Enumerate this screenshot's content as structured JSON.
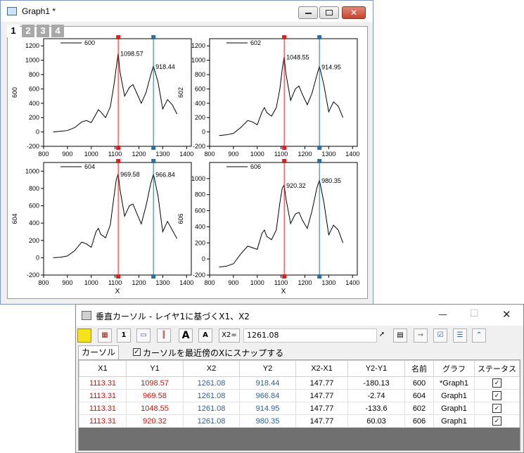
{
  "graph_window": {
    "title": "Graph1 *",
    "layer_tabs": [
      "1",
      "2",
      "3",
      "4"
    ],
    "close_glyph": "✕"
  },
  "charts": [
    {
      "ylabel": "600",
      "legend": "600",
      "xlabel": "",
      "labels": [
        "1098.57",
        "918.44"
      ]
    },
    {
      "ylabel": "602",
      "legend": "602",
      "xlabel": "",
      "labels": [
        "1048.55",
        "914.95"
      ]
    },
    {
      "ylabel": "604",
      "legend": "604",
      "xlabel": "X",
      "labels": [
        "969.58",
        "966.84"
      ]
    },
    {
      "ylabel": "606",
      "legend": "606",
      "xlabel": "X",
      "labels": [
        "920.32",
        "980.35"
      ]
    }
  ],
  "chart_data": [
    {
      "type": "line",
      "series": [
        {
          "name": "600",
          "color": "#000000",
          "x": [
            840,
            870,
            900,
            930,
            960,
            980,
            1000,
            1020,
            1030,
            1040,
            1060,
            1080,
            1095,
            1105,
            1113,
            1120,
            1140,
            1160,
            1175,
            1190,
            1210,
            1230,
            1250,
            1261,
            1280,
            1300,
            1320,
            1340,
            1360
          ],
          "y": [
            0,
            10,
            20,
            60,
            140,
            160,
            130,
            250,
            310,
            280,
            200,
            350,
            650,
            900,
            1098,
            850,
            500,
            620,
            660,
            550,
            400,
            550,
            800,
            918,
            700,
            320,
            450,
            380,
            250
          ]
        }
      ],
      "xlim": [
        800,
        1420
      ],
      "ylim": [
        -200,
        1300
      ],
      "xticks": [
        800,
        900,
        1000,
        1100,
        1200,
        1300,
        1400
      ],
      "yticks": [
        -200,
        0,
        200,
        400,
        600,
        800,
        1000,
        1200
      ],
      "cursors": [
        {
          "x": 1113.31,
          "y": 1098.57,
          "color": "#e02020"
        },
        {
          "x": 1261.08,
          "y": 918.44,
          "color": "#2d6f9f"
        }
      ]
    },
    {
      "type": "line",
      "series": [
        {
          "name": "602",
          "color": "#000000",
          "x": [
            840,
            870,
            900,
            930,
            960,
            980,
            1000,
            1020,
            1030,
            1040,
            1060,
            1080,
            1095,
            1105,
            1113,
            1120,
            1140,
            1160,
            1175,
            1190,
            1210,
            1230,
            1250,
            1261,
            1280,
            1300,
            1320,
            1340,
            1360
          ],
          "y": [
            -50,
            -40,
            -20,
            60,
            160,
            140,
            100,
            280,
            340,
            270,
            220,
            340,
            600,
            880,
            1048,
            820,
            440,
            600,
            640,
            520,
            380,
            540,
            790,
            914,
            650,
            280,
            420,
            360,
            200
          ]
        }
      ],
      "xlim": [
        800,
        1420
      ],
      "ylim": [
        -200,
        1300
      ],
      "xticks": [
        800,
        900,
        1000,
        1100,
        1200,
        1300,
        1400
      ],
      "yticks": [
        -200,
        0,
        200,
        400,
        600,
        800,
        1000,
        1200
      ],
      "cursors": [
        {
          "x": 1113.31,
          "y": 1048.55,
          "color": "#e02020"
        },
        {
          "x": 1261.08,
          "y": 914.95,
          "color": "#2d6f9f"
        }
      ]
    },
    {
      "type": "line",
      "series": [
        {
          "name": "604",
          "color": "#000000",
          "x": [
            840,
            870,
            900,
            930,
            960,
            980,
            1000,
            1020,
            1030,
            1040,
            1060,
            1080,
            1095,
            1105,
            1113,
            1120,
            1140,
            1160,
            1175,
            1190,
            1210,
            1230,
            1250,
            1261,
            1280,
            1300,
            1320,
            1340,
            1360
          ],
          "y": [
            0,
            5,
            20,
            80,
            180,
            160,
            120,
            300,
            340,
            270,
            230,
            380,
            700,
            900,
            969,
            800,
            480,
            600,
            620,
            520,
            390,
            600,
            860,
            966,
            720,
            300,
            420,
            320,
            220
          ]
        }
      ],
      "xlim": [
        800,
        1420
      ],
      "ylim": [
        -200,
        1100
      ],
      "xticks": [
        800,
        900,
        1000,
        1100,
        1200,
        1300,
        1400
      ],
      "yticks": [
        -200,
        0,
        200,
        400,
        600,
        800,
        1000
      ],
      "cursors": [
        {
          "x": 1113.31,
          "y": 969.58,
          "color": "#e02020"
        },
        {
          "x": 1261.08,
          "y": 966.84,
          "color": "#2d6f9f"
        }
      ]
    },
    {
      "type": "line",
      "series": [
        {
          "name": "606",
          "color": "#000000",
          "x": [
            840,
            870,
            900,
            930,
            960,
            980,
            1000,
            1020,
            1030,
            1040,
            1060,
            1080,
            1095,
            1105,
            1113,
            1120,
            1140,
            1160,
            1175,
            1190,
            1210,
            1230,
            1250,
            1261,
            1280,
            1300,
            1320,
            1340,
            1360
          ],
          "y": [
            -100,
            -90,
            -60,
            60,
            160,
            140,
            120,
            320,
            360,
            280,
            240,
            360,
            700,
            880,
            920,
            760,
            440,
            560,
            580,
            480,
            380,
            600,
            880,
            980,
            700,
            300,
            420,
            360,
            200
          ]
        }
      ],
      "xlim": [
        800,
        1420
      ],
      "ylim": [
        -200,
        1200
      ],
      "xticks": [
        800,
        900,
        1000,
        1100,
        1200,
        1300,
        1400
      ],
      "yticks": [
        -200,
        0,
        200,
        400,
        600,
        800,
        1000
      ],
      "cursors": [
        {
          "x": 1113.31,
          "y": 920.32,
          "color": "#e02020"
        },
        {
          "x": 1261.08,
          "y": 980.35,
          "color": "#2d6f9f"
        }
      ]
    }
  ],
  "cursor_dialog": {
    "title": "垂直カーソル - レイヤ1に基づくX1、X2",
    "x2_label": "X2=",
    "x2_value": "1261.08",
    "tab_label": "カーソル",
    "snap_label": "カーソルを最近傍のXにスナップする",
    "snap_checked": "✓",
    "columns": [
      "X1",
      "Y1",
      "X2",
      "Y2",
      "X2-X1",
      "Y2-Y1",
      "名前",
      "グラフ",
      "ステータス"
    ],
    "rows": [
      [
        "1113.31",
        "1098.57",
        "1261.08",
        "918.44",
        "147.77",
        "-180.13",
        "600",
        "*Graph1",
        "✓"
      ],
      [
        "1113.31",
        "969.58",
        "1261.08",
        "966.84",
        "147.77",
        "-2.74",
        "604",
        "Graph1",
        "✓"
      ],
      [
        "1113.31",
        "1048.55",
        "1261.08",
        "914.95",
        "147.77",
        "-133.6",
        "602",
        "Graph1",
        "✓"
      ],
      [
        "1113.31",
        "920.32",
        "1261.08",
        "980.35",
        "147.77",
        "60.03",
        "606",
        "Graph1",
        "✓"
      ]
    ],
    "buttons": {
      "minimize": "—",
      "maximize": "☐",
      "close": "✕"
    }
  },
  "colors": {
    "cursor1": "#e02020",
    "cursor2": "#2d6f9f",
    "accent": "#2d5f94"
  }
}
